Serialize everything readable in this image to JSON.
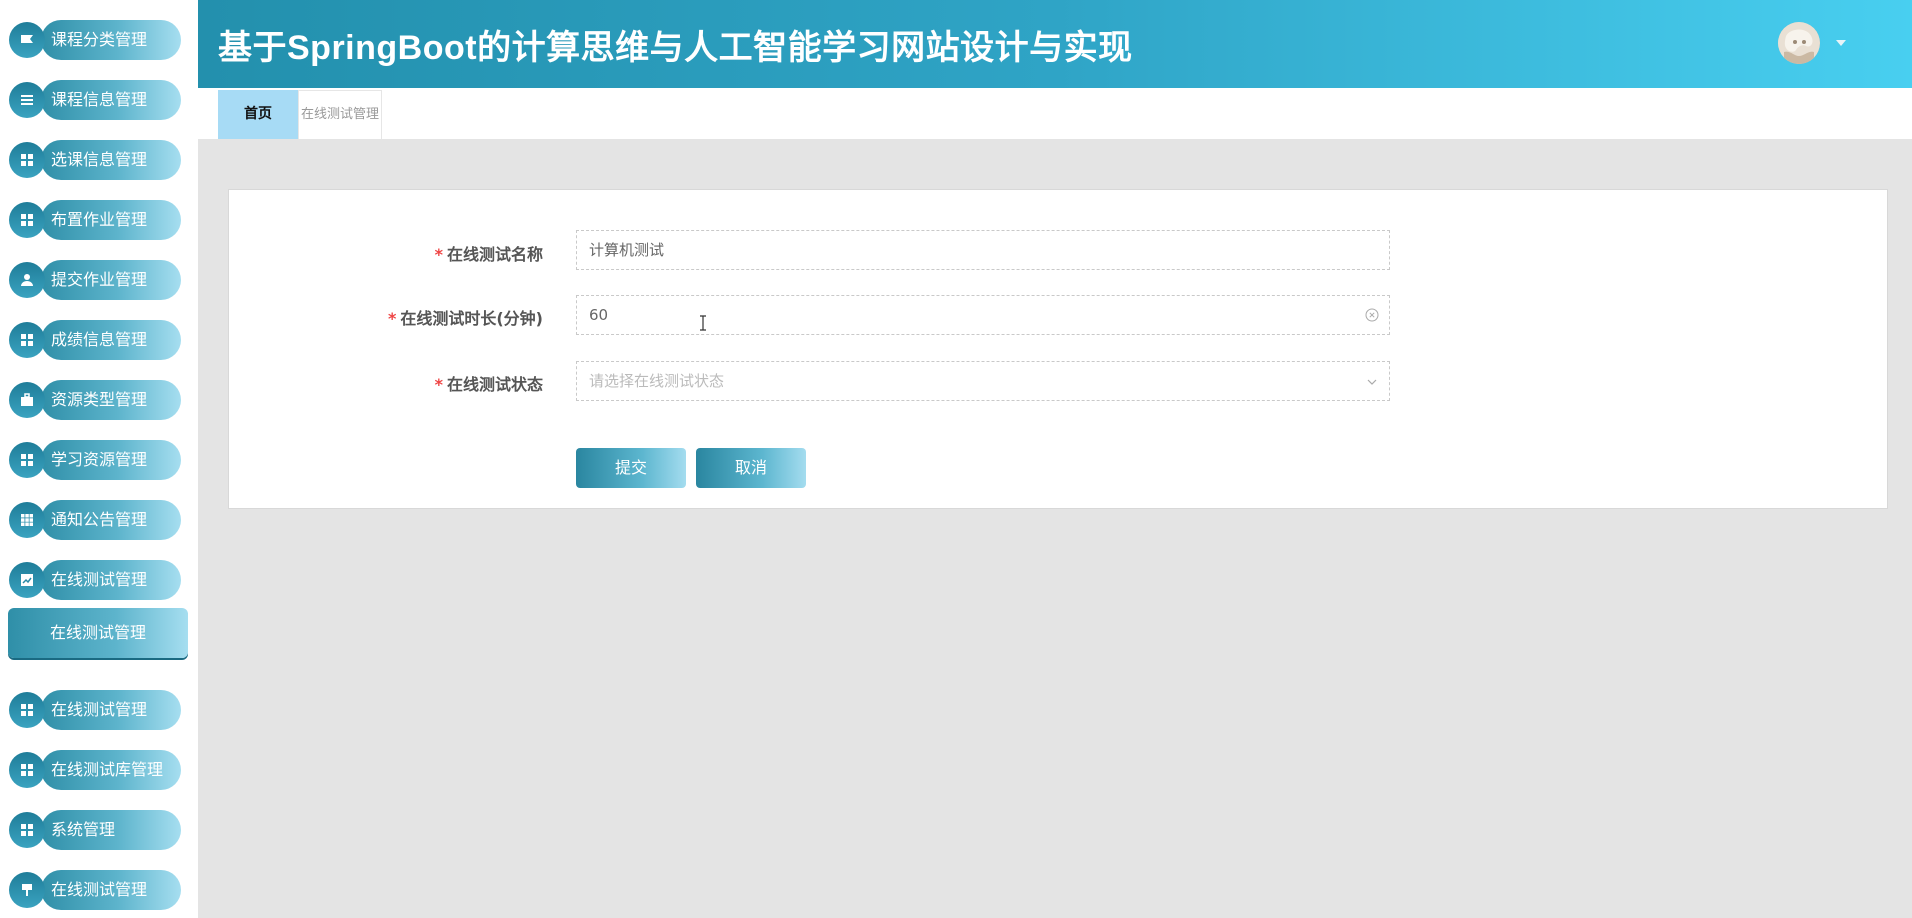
{
  "app": {
    "title": "基于SpringBoot的计算思维与人工智能学习网站设计与实现"
  },
  "sidebar": {
    "items": [
      {
        "label": "课程分类管理",
        "icon": "flag-icon"
      },
      {
        "label": "课程信息管理",
        "icon": "list-icon"
      },
      {
        "label": "选课信息管理",
        "icon": "grid-icon"
      },
      {
        "label": "布置作业管理",
        "icon": "grid-icon"
      },
      {
        "label": "提交作业管理",
        "icon": "user-icon"
      },
      {
        "label": "成绩信息管理",
        "icon": "grid-icon"
      },
      {
        "label": "资源类型管理",
        "icon": "briefcase-icon"
      },
      {
        "label": "学习资源管理",
        "icon": "grid-icon"
      },
      {
        "label": "通知公告管理",
        "icon": "table-icon"
      },
      {
        "label": "在线测试管理",
        "icon": "chart-icon"
      }
    ],
    "active_sub_item": "在线测试管理",
    "items_after": [
      {
        "label": "在线测试管理",
        "icon": "grid-icon"
      },
      {
        "label": "在线测试库管理",
        "icon": "grid-icon"
      },
      {
        "label": "系统管理",
        "icon": "grid-icon"
      },
      {
        "label": "在线测试管理",
        "icon": "pin-icon"
      }
    ]
  },
  "tabs": {
    "home": "首页",
    "current": "在线测试管理"
  },
  "form": {
    "fields": [
      {
        "label": "在线测试名称",
        "value": "计算机测试",
        "placeholder": ""
      },
      {
        "label": "在线测试时长(分钟)",
        "value": "60",
        "placeholder": ""
      },
      {
        "label": "在线测试状态",
        "value": "",
        "placeholder": "请选择在线测试状态"
      }
    ],
    "required_mark": "*",
    "submit_label": "提交",
    "cancel_label": "取消"
  },
  "colors": {
    "accent": "#2fa4c6",
    "tab_active": "#a7dbf5",
    "required": "#ee4444"
  }
}
